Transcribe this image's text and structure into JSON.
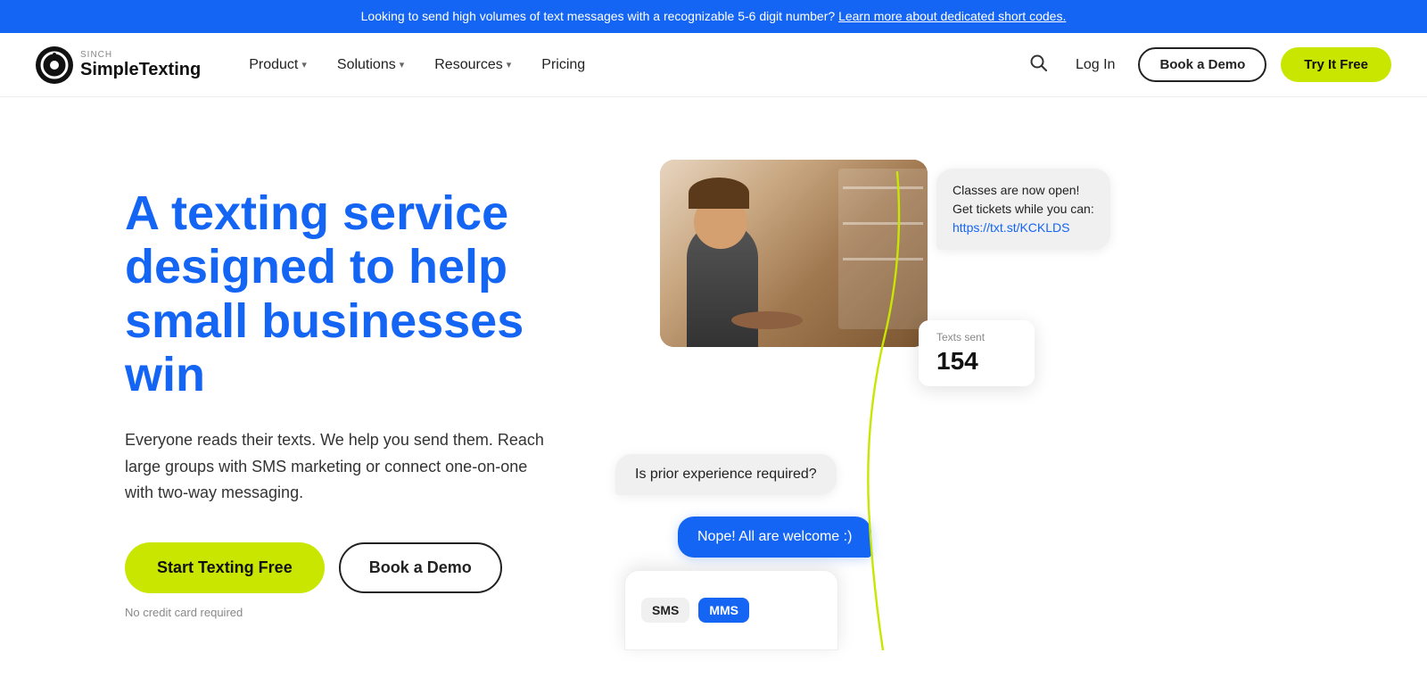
{
  "banner": {
    "text": "Looking to send high volumes of text messages with a recognizable 5-6 digit number?",
    "link_text": "Learn more about dedicated short codes."
  },
  "navbar": {
    "logo": {
      "sinch_label": "SINCH",
      "brand_label": "SimpleTexting"
    },
    "nav_items": [
      {
        "label": "Product",
        "has_chevron": true
      },
      {
        "label": "Solutions",
        "has_chevron": true
      },
      {
        "label": "Resources",
        "has_chevron": true
      },
      {
        "label": "Pricing",
        "has_chevron": false
      }
    ],
    "login_label": "Log In",
    "book_demo_label": "Book a Demo",
    "try_free_label": "Try It Free"
  },
  "hero": {
    "title": "A texting service designed to help small businesses win",
    "subtitle": "Everyone reads their texts. We help you send them. Reach large groups with SMS marketing or connect one-on-one with two-way messaging.",
    "cta_primary": "Start Texting Free",
    "cta_secondary": "Book a Demo",
    "no_cc_text": "No credit card required",
    "message_bubble_top": {
      "line1": "Classes are now open!",
      "line2": "Get tickets while you can:",
      "line3": "https://txt.st/KCKLDS"
    },
    "texts_sent_label": "Texts sent",
    "texts_sent_count": "154",
    "message_question": "Is prior experience required?",
    "message_reply": "Nope! All are welcome :)",
    "sms_tag": "SMS",
    "mms_tag": "MMS"
  },
  "colors": {
    "brand_blue": "#1565f5",
    "brand_yellow": "#c8e600",
    "text_dark": "#111111",
    "text_medium": "#333333",
    "text_light": "#888888",
    "bubble_bg": "#f0f0f0",
    "reply_bg": "#1565f5"
  }
}
